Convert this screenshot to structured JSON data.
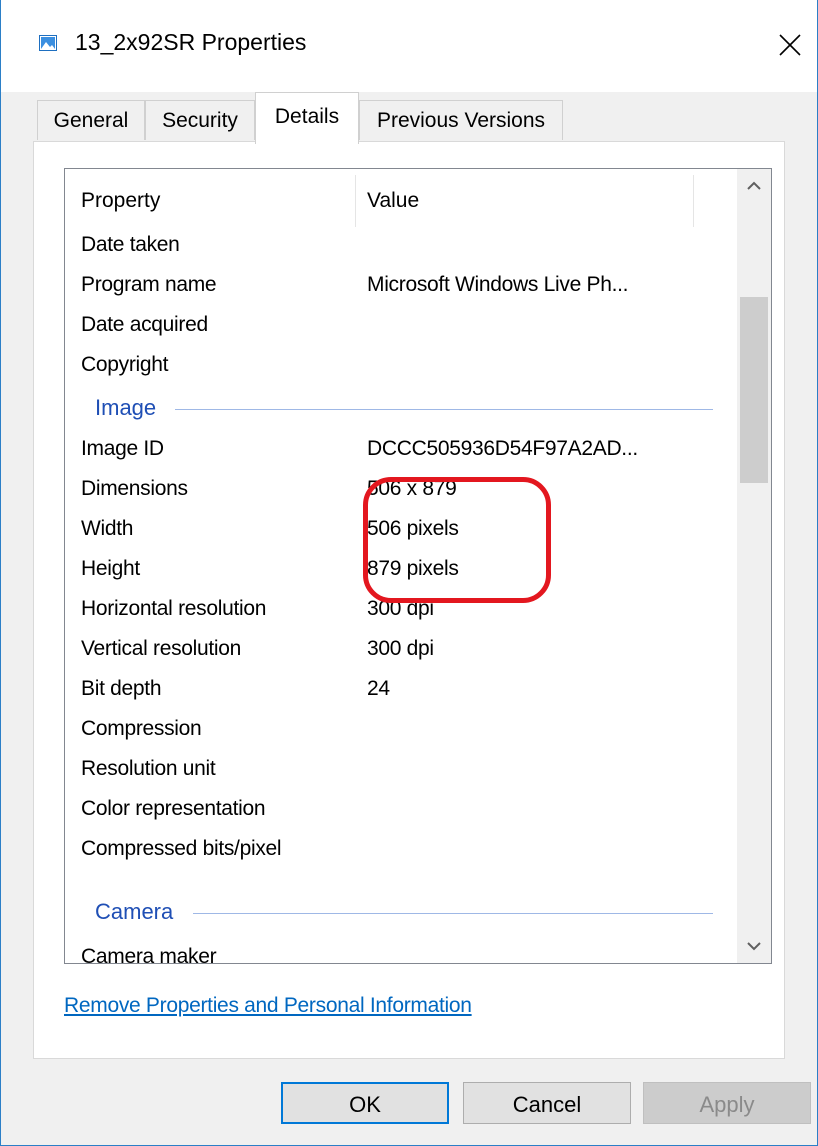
{
  "window": {
    "title": "13_2x92SR Properties",
    "accent": "#2b7fc7",
    "icon": "image-file-icon"
  },
  "tabs": [
    {
      "label": "General",
      "active": false
    },
    {
      "label": "Security",
      "active": false
    },
    {
      "label": "Details",
      "active": true
    },
    {
      "label": "Previous Versions",
      "active": false
    }
  ],
  "list": {
    "headers": {
      "property": "Property",
      "value": "Value"
    },
    "rows": [
      {
        "name": "Date taken",
        "value": ""
      },
      {
        "name": "Program name",
        "value": "Microsoft Windows Live Ph..."
      },
      {
        "name": "Date acquired",
        "value": ""
      },
      {
        "name": "Copyright",
        "value": ""
      }
    ],
    "image_group": {
      "label": "Image",
      "rows": [
        {
          "name": "Image ID",
          "value": "DCCC505936D54F97A2AD..."
        },
        {
          "name": "Dimensions",
          "value": "506 x 879"
        },
        {
          "name": "Width",
          "value": "506 pixels"
        },
        {
          "name": "Height",
          "value": "879 pixels"
        },
        {
          "name": "Horizontal resolution",
          "value": "300 dpi"
        },
        {
          "name": "Vertical resolution",
          "value": "300 dpi"
        },
        {
          "name": "Bit depth",
          "value": "24"
        },
        {
          "name": "Compression",
          "value": ""
        },
        {
          "name": "Resolution unit",
          "value": ""
        },
        {
          "name": "Color representation",
          "value": ""
        },
        {
          "name": "Compressed bits/pixel",
          "value": ""
        }
      ]
    },
    "camera_group": {
      "label": "Camera",
      "rows": [
        {
          "name": "Camera maker",
          "value": ""
        }
      ]
    }
  },
  "annotation_color": "#e3171f",
  "link": "Remove Properties and Personal Information",
  "buttons": {
    "ok": "OK",
    "cancel": "Cancel",
    "apply": "Apply"
  }
}
